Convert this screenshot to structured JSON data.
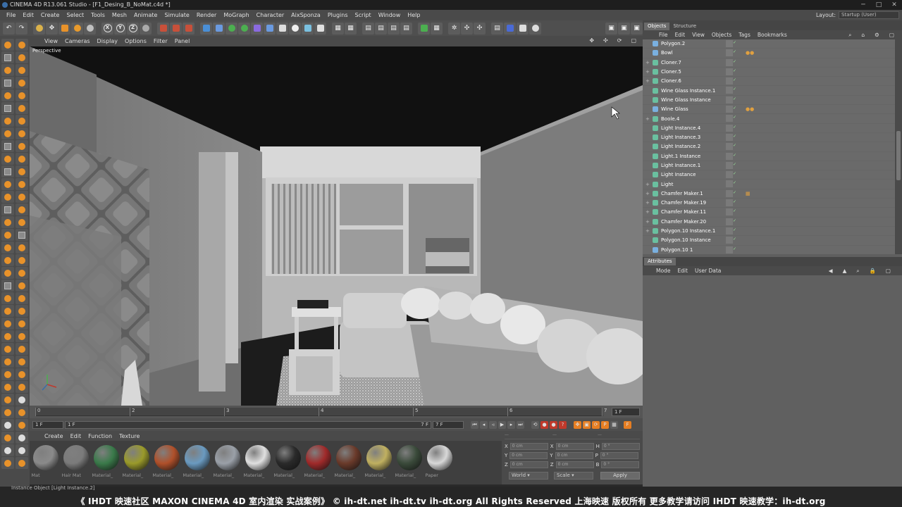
{
  "window": {
    "title": "CINEMA 4D R13.061 Studio - [F1_Desing_B_NoMat.c4d *]"
  },
  "menu": [
    "File",
    "Edit",
    "Create",
    "Select",
    "Tools",
    "Mesh",
    "Animate",
    "Simulate",
    "Render",
    "MoGraph",
    "Character",
    "AixSponza",
    "Plugins",
    "Script",
    "Window",
    "Help"
  ],
  "layout": {
    "label": "Layout:",
    "value": "Startup (User)"
  },
  "viewport": {
    "menu": [
      "View",
      "Cameras",
      "Display",
      "Options",
      "Filter",
      "Panel"
    ],
    "label": "Perspective"
  },
  "timeline": {
    "ticks": [
      "0",
      "2",
      "3",
      "4",
      "5",
      "6",
      "7"
    ],
    "end_label": "1 F"
  },
  "transport": {
    "start": "1 F",
    "current": "1 F",
    "end": "7 F",
    "end2": "7 F"
  },
  "material_panel": {
    "menu": [
      "Create",
      "Edit",
      "Function",
      "Texture"
    ],
    "materials": [
      {
        "name": "Mat",
        "color": "#8a8a8a"
      },
      {
        "name": "Hair Mat",
        "color": "#7b7b7b"
      },
      {
        "name": "Material_",
        "color": "#3a7a4a"
      },
      {
        "name": "Material_",
        "color": "#9a9a2a"
      },
      {
        "name": "Material_",
        "color": "#b0502a"
      },
      {
        "name": "Material_",
        "color": "#6a9ac0"
      },
      {
        "name": "Material_",
        "color": "#9aa0a8"
      },
      {
        "name": "Material_",
        "color": "#e0e0e0"
      },
      {
        "name": "Material_",
        "color": "#2a2a2a"
      },
      {
        "name": "Material_",
        "color": "#a02a2a"
      },
      {
        "name": "Material_",
        "color": "#6a3a2a"
      },
      {
        "name": "Material_",
        "color": "#c0b060"
      },
      {
        "name": "Material_",
        "color": "#3a4a3a"
      },
      {
        "name": "Paper",
        "color": "#d8d8d8"
      }
    ]
  },
  "coords": {
    "rows": [
      {
        "a": "X",
        "av": "0 cm",
        "b": "X",
        "bv": "0 cm",
        "c": "H",
        "cv": "0 °"
      },
      {
        "a": "Y",
        "av": "0 cm",
        "b": "Y",
        "bv": "0 cm",
        "c": "P",
        "cv": "0 °"
      },
      {
        "a": "Z",
        "av": "0 cm",
        "b": "Z",
        "bv": "0 cm",
        "c": "B",
        "cv": "0 °"
      }
    ],
    "world": "World",
    "scale": "Scale",
    "apply": "Apply"
  },
  "objects_panel": {
    "tabs": [
      "Objects",
      "Structure"
    ],
    "menu": [
      "File",
      "Edit",
      "View",
      "Objects",
      "Tags",
      "Bookmarks"
    ],
    "rows": [
      {
        "name": "Polygon.2",
        "icon": "#7ab0e0",
        "tag": ""
      },
      {
        "name": "Bowl",
        "icon": "#7ab0e0",
        "tag": "●●"
      },
      {
        "name": "Cloner.7",
        "icon": "#6ac0a0",
        "tag": "",
        "exp": "+"
      },
      {
        "name": "Cloner.5",
        "icon": "#6ac0a0",
        "tag": "",
        "exp": "+"
      },
      {
        "name": "Cloner.6",
        "icon": "#6ac0a0",
        "tag": "",
        "exp": "+"
      },
      {
        "name": "Wine Glass Instance.1",
        "icon": "#6ac0a0",
        "tag": ""
      },
      {
        "name": "Wine Glass Instance",
        "icon": "#6ac0a0",
        "tag": ""
      },
      {
        "name": "Wine Glass",
        "icon": "#7ab0e0",
        "tag": "●●"
      },
      {
        "name": "Boole.4",
        "icon": "#6ac0a0",
        "tag": "",
        "exp": "+"
      },
      {
        "name": "Light Instance.4",
        "icon": "#6ac0a0",
        "tag": ""
      },
      {
        "name": "Light Instance.3",
        "icon": "#6ac0a0",
        "tag": ""
      },
      {
        "name": "Light Instance.2",
        "icon": "#6ac0a0",
        "tag": ""
      },
      {
        "name": "Light.1 Instance",
        "icon": "#6ac0a0",
        "tag": ""
      },
      {
        "name": "Light Instance.1",
        "icon": "#6ac0a0",
        "tag": ""
      },
      {
        "name": "Light Instance",
        "icon": "#6ac0a0",
        "tag": ""
      },
      {
        "name": "Light",
        "icon": "#6ac0a0",
        "tag": "",
        "exp": "+"
      },
      {
        "name": "Chamfer Maker.1",
        "icon": "#6ac0a0",
        "tag": "▦",
        "exp": "+"
      },
      {
        "name": "Chamfer Maker.19",
        "icon": "#6ac0a0",
        "tag": "",
        "exp": "+"
      },
      {
        "name": "Chamfer Maker.11",
        "icon": "#6ac0a0",
        "tag": "",
        "exp": "+"
      },
      {
        "name": "Chamfer Maker.20",
        "icon": "#6ac0a0",
        "tag": "",
        "exp": "+"
      },
      {
        "name": "Polygon.10 Instance.1",
        "icon": "#6ac0a0",
        "tag": "",
        "exp": "+"
      },
      {
        "name": "Polygon.10 Instance",
        "icon": "#6ac0a0",
        "tag": ""
      },
      {
        "name": "Polygon.10 1",
        "icon": "#7ab0e0",
        "tag": ""
      }
    ]
  },
  "attributes_panel": {
    "tab": "Attributes",
    "menu": [
      "Mode",
      "Edit",
      "User Data"
    ]
  },
  "status": {
    "text": "Instance Object [Light Instance.2]",
    "banner": "《 IHDT 映速社区 MAXON CINEMA 4D 室内渲染 实战案例》   © ih-dt.net ih-dt.tv  ih-dt.org  All Rights Reserved 上海映速 版权所有    更多教学请访问 IHDT 映速教学：ih-dt.org"
  }
}
